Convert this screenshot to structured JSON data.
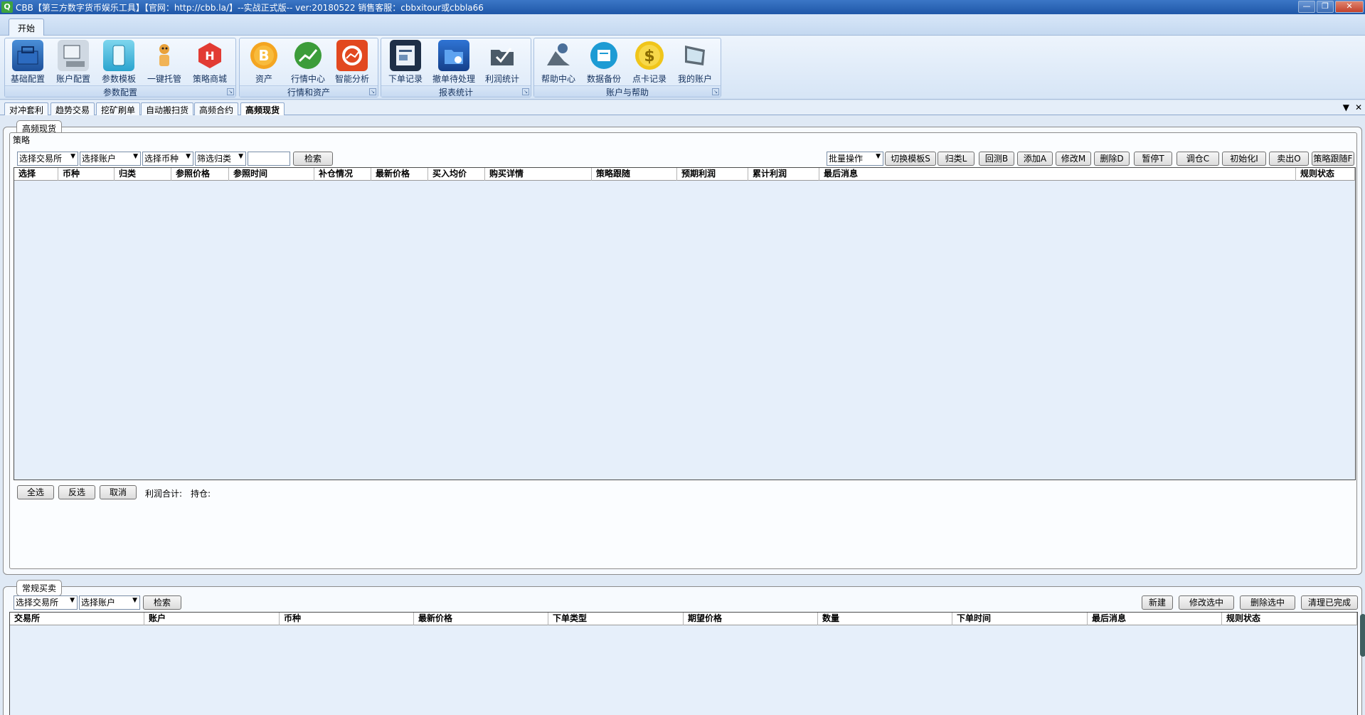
{
  "window": {
    "title": "CBB【第三方数字货币娱乐工具】【官网：http://cbb.la/】--实战正式版-- ver:20180522   销售客服：cbbxitour或cbbla66",
    "minimize": "0",
    "restore": "1",
    "close": "r"
  },
  "ribbon": {
    "tab": "开始",
    "groups": [
      {
        "label": "参数配置",
        "buttons": [
          "基础配置",
          "账户配置",
          "参数模板",
          "一键托管",
          "策略商城"
        ]
      },
      {
        "label": "行情和资产",
        "buttons": [
          "资产",
          "行情中心",
          "智能分析"
        ]
      },
      {
        "label": "报表统计",
        "buttons": [
          "下单记录",
          "撤单待处理",
          "利润统计"
        ]
      },
      {
        "label": "账户与帮助",
        "buttons": [
          "帮助中心",
          "数据备份",
          "点卡记录",
          "我的账户"
        ]
      }
    ],
    "colors": {
      "ribbon_bg": "#dce9f8",
      "title_bg": "#1f57a8",
      "grid_bg": "#e6effa"
    }
  },
  "doc_tabs": [
    "对冲套利",
    "趋势交易",
    "挖矿刷单",
    "自动搬扫货",
    "高频合约",
    "高频现货"
  ],
  "doc_tabs_active": "高频现货",
  "top_panel": {
    "legend": "高频现货",
    "inner_legend": "策略",
    "filters": {
      "exchange": "选择交易所",
      "account": "选择账户",
      "coin": "选择币种",
      "category": "筛选归类",
      "search": "检索"
    },
    "batch": "批量操作",
    "actions": [
      "切换模板S",
      "归类L",
      "回测B",
      "添加A",
      "修改M",
      "删除D",
      "暂停T",
      "调仓C",
      "初始化I",
      "卖出O",
      "策略跟随F"
    ],
    "columns": [
      "选择",
      "币种",
      "归类",
      "参照价格",
      "参照时间",
      "补仓情况",
      "最新价格",
      "买入均价",
      "购买详情",
      "策略跟随",
      "预期利润",
      "累计利润",
      "最后消息",
      "规则状态"
    ],
    "rows": [],
    "footer": {
      "select_all": "全选",
      "invert": "反选",
      "cancel": "取消",
      "profit_label": "利润合计:",
      "position_label": "持仓:"
    }
  },
  "bottom_panel": {
    "legend": "常规买卖",
    "filters": {
      "exchange": "选择交易所",
      "account": "选择账户",
      "search": "检索"
    },
    "actions": [
      "新建",
      "修改选中",
      "删除选中",
      "清理已完成"
    ],
    "columns": [
      "交易所",
      "账户",
      "币种",
      "最新价格",
      "下单类型",
      "期望价格",
      "数量",
      "下单时间",
      "最后消息",
      "规则状态"
    ],
    "rows": []
  }
}
